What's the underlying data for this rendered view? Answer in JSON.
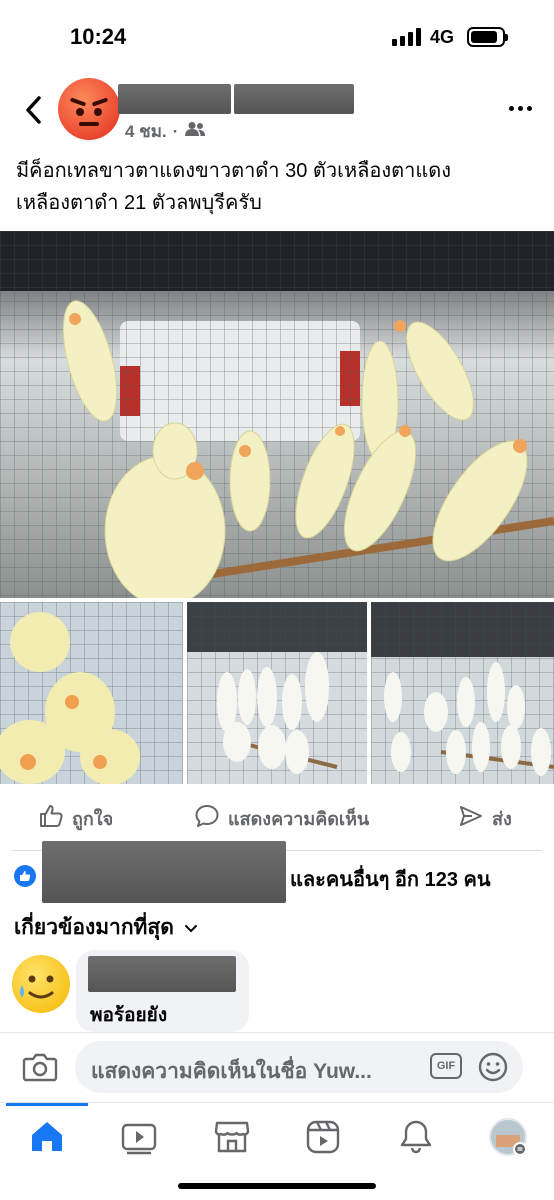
{
  "status_bar": {
    "time": "10:24",
    "network": "4G"
  },
  "post": {
    "time_ago": "4 ชม.",
    "separator": "·",
    "caption_line1": "มีค็อกเทลขาวตาแดงขาวตาดำ 30 ตัวเหลืองตาแดง",
    "caption_line2": "เหลืองตาดำ 21 ตัวลพบุรีครับ"
  },
  "actions": {
    "like": "ถูกใจ",
    "comment": "แสดงความคิดเห็น",
    "share": "ส่ง"
  },
  "reactions": {
    "others_text": "และคนอื่นๆ อีก 123 คน"
  },
  "comments": {
    "sort_label": "เกี่ยวข้องมากที่สุด",
    "items": [
      {
        "text": "พอร้อยยัง"
      }
    ]
  },
  "composer": {
    "placeholder": "แสดงความคิดเห็นในชื่อ Yuw...",
    "gif_label": "GIF"
  },
  "colors": {
    "accent": "#1877f2",
    "secondary_text": "#65676b",
    "bubble_bg": "#f0f2f5"
  },
  "icons": {
    "back": "chevron-left-icon",
    "audience": "friends-icon",
    "more": "more-horizontal-icon",
    "like": "thumbs-up-icon",
    "comment": "comment-bubble-icon",
    "share": "send-icon",
    "camera": "camera-icon",
    "emoji": "smiley-icon",
    "tabs": [
      "home-icon",
      "video-icon",
      "marketplace-icon",
      "reels-icon",
      "bell-icon",
      "profile-avatar"
    ]
  }
}
